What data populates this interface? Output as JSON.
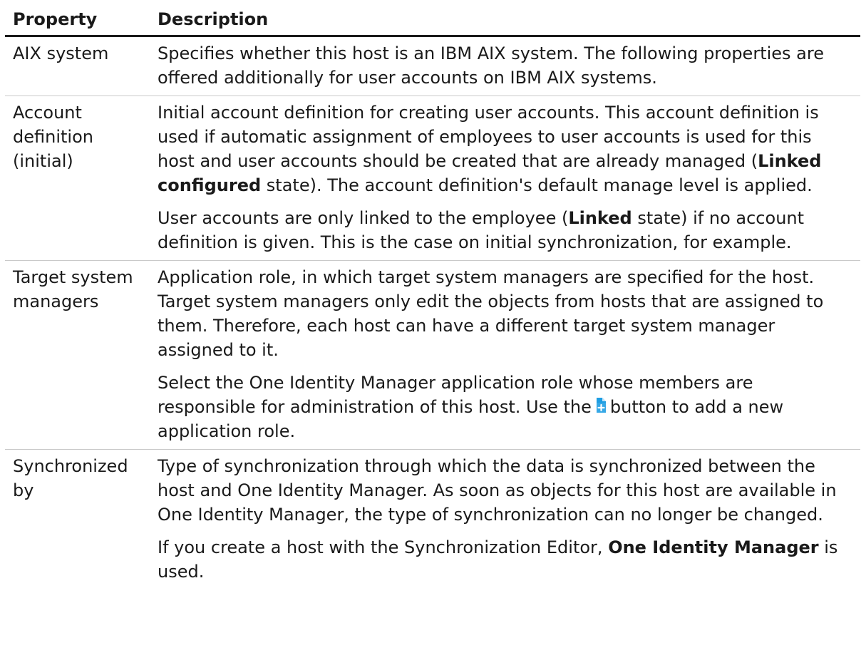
{
  "header": {
    "property": "Property",
    "description": "Description"
  },
  "rows": [
    {
      "property": "AIX system",
      "p1": "Specifies whether this host is an IBM AIX system. The following properties are offered additionally for user accounts on IBM AIX systems."
    },
    {
      "property": "Account definition (initial)",
      "p1_a": "Initial account definition for creating user accounts. This account definition is used if automatic assignment of employees to user accounts is used for this host and user accounts should be created that are already managed (",
      "p1_b": "Linked configured",
      "p1_c": " state). The account definition's default manage level is applied.",
      "p2_a": "User accounts are only linked to the employee (",
      "p2_b": "Linked",
      "p2_c": " state) if no account definition is given. This is the case on initial synchronization, for example."
    },
    {
      "property": "Target system managers",
      "p1": "Application role, in which target system managers are specified for the host. Target system managers only edit the objects from hosts that are assigned to them. Therefore, each host can have a different target system manager assigned to it.",
      "p2_a": "Select the One Identity Manager application role whose members are responsible for administration of this host. Use the",
      "p2_icon": "add-document-icon",
      "p2_b": "button to add a new application role."
    },
    {
      "property": "Synchronized by",
      "p1": "Type of synchronization through which the data is synchronized between the host and One Identity Manager. As soon as objects for this host are available in One Identity Manager, the type of synchronization can no longer be changed.",
      "p2_a": "If you create a host with the Synchronization Editor, ",
      "p2_b": "One Identity Manager",
      "p2_c": " is used."
    }
  ],
  "colors": {
    "text": "#1a1a1a",
    "rule": "#c9c9c9",
    "icon_blue": "#1e9ee3"
  }
}
